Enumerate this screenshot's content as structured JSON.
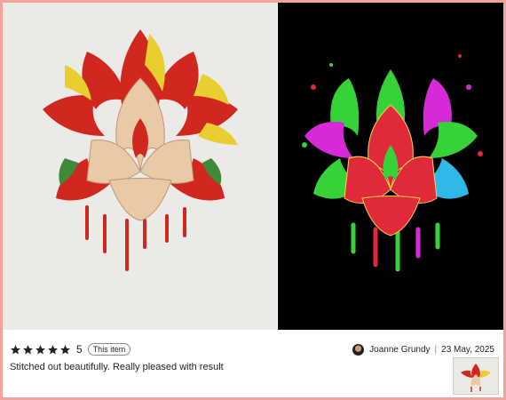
{
  "review": {
    "rating_value": "5",
    "star_count": 5,
    "this_item_label": "This item",
    "reviewer_name": "Joanne Grundy",
    "date": "23 May, 2025",
    "text": "Stitched out beautifully. Really pleased with result"
  },
  "icons": {
    "star": "star-icon",
    "avatar": "avatar"
  },
  "colors": {
    "star": "#222222",
    "frame": "#f4a39a",
    "left_photo_bg": "#eceae6",
    "right_photo_bg": "#000000"
  },
  "photos": {
    "left": "embroidered mandala on white fabric",
    "right": "neon lotus mandala design on black"
  }
}
